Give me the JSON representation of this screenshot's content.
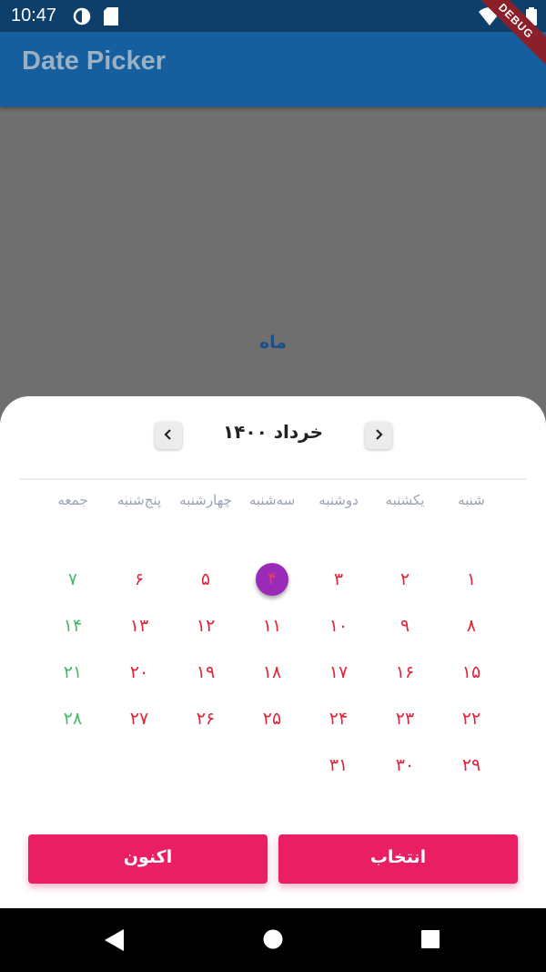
{
  "status_bar": {
    "time": "10:47"
  },
  "app_bar": {
    "title": "Date Picker",
    "debug_label": "DEBUG"
  },
  "background": {
    "label": "ماه"
  },
  "picker": {
    "month_year": "خرداد ۱۴۰۰",
    "prev_icon": "chevron-left-icon",
    "next_icon": "chevron-right-icon",
    "weekdays": [
      "شنبه",
      "یکشنبه",
      "دوشنبه",
      "سه‌شنبه",
      "چهارشنبه",
      "پنج‌شنبه",
      "جمعه"
    ],
    "selected_day": "۴",
    "days": [
      "۱",
      "۲",
      "۳",
      "۴",
      "۵",
      "۶",
      "۷",
      "۸",
      "۹",
      "۱۰",
      "۱۱",
      "۱۲",
      "۱۳",
      "۱۴",
      "۱۵",
      "۱۶",
      "۱۷",
      "۱۸",
      "۱۹",
      "۲۰",
      "۲۱",
      "۲۲",
      "۲۳",
      "۲۴",
      "۲۵",
      "۲۶",
      "۲۷",
      "۲۸",
      "۲۹",
      "۳۰",
      "۳۱"
    ],
    "holiday_color": "#49b96b",
    "day_color": "#e0243a",
    "selected_color": "#9c2ab8"
  },
  "buttons": {
    "select_label": "انتخاب",
    "now_label": "اکنون",
    "accent": "#e91e63"
  },
  "system_nav": {
    "back": "back-icon",
    "home": "home-icon",
    "recents": "recents-icon"
  }
}
